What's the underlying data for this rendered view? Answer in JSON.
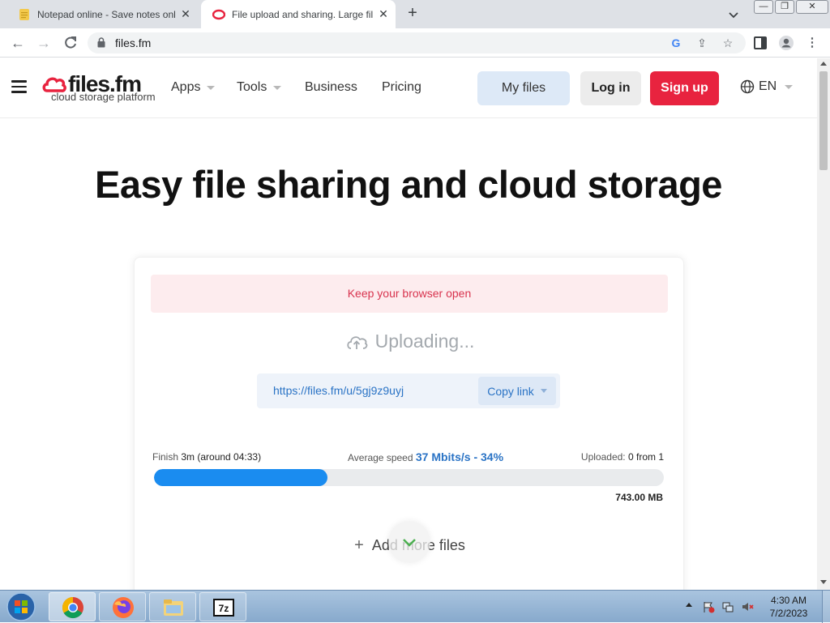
{
  "browser": {
    "tabs": [
      {
        "title": "Notepad online - Save notes onl",
        "active": false
      },
      {
        "title": "File upload and sharing. Large fil",
        "active": true
      }
    ],
    "address": "files.fm"
  },
  "site": {
    "logo_name": "files.fm",
    "logo_tagline": "cloud storage platform",
    "nav": {
      "apps": "Apps",
      "tools": "Tools",
      "business": "Business",
      "pricing": "Pricing"
    },
    "buttons": {
      "my_files": "My files",
      "log_in": "Log in",
      "sign_up": "Sign up"
    },
    "language": "EN"
  },
  "hero_title": "Easy file sharing and cloud storage",
  "upload": {
    "warning": "Keep your browser open",
    "status": "Uploading...",
    "link": "https://files.fm/u/5gj9z9uyj",
    "copy_link": "Copy link",
    "finish_label": "Finish",
    "finish_value": "3m (around 04:33)",
    "speed_label": "Average speed",
    "speed_value": "37 Mbits/s - 34%",
    "uploaded_label": "Uploaded:",
    "uploaded_value": "0 from 1",
    "progress_percent": 34,
    "total_size": "743.00 MB",
    "add_more": "Add more files"
  },
  "taskbar": {
    "time": "4:30 AM",
    "date": "7/2/2023"
  },
  "colors": {
    "accent_red": "#e8233f",
    "progress_blue": "#1a8cf0",
    "link_blue": "#2a73c5"
  }
}
